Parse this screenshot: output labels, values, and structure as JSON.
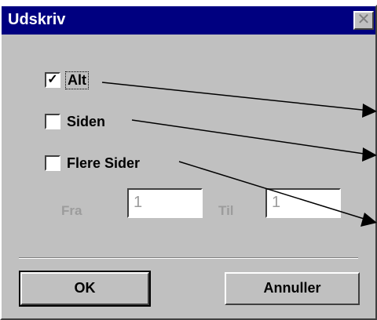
{
  "window": {
    "title": "Udskriv",
    "close_glyph": "✕"
  },
  "options": [
    {
      "label": "Alt",
      "checked": true,
      "check_glyph": "✓"
    },
    {
      "label": "Siden",
      "checked": false
    },
    {
      "label": "Flere Sider",
      "checked": false
    }
  ],
  "range": {
    "from_label": "Fra",
    "from_value": "1",
    "to_label": "Til",
    "to_value": "1"
  },
  "buttons": {
    "ok": "OK",
    "cancel": "Annuller"
  },
  "colors": {
    "titlebar": "#000080",
    "face": "#c0c0c0",
    "disabled_text": "#9c9c9c"
  }
}
